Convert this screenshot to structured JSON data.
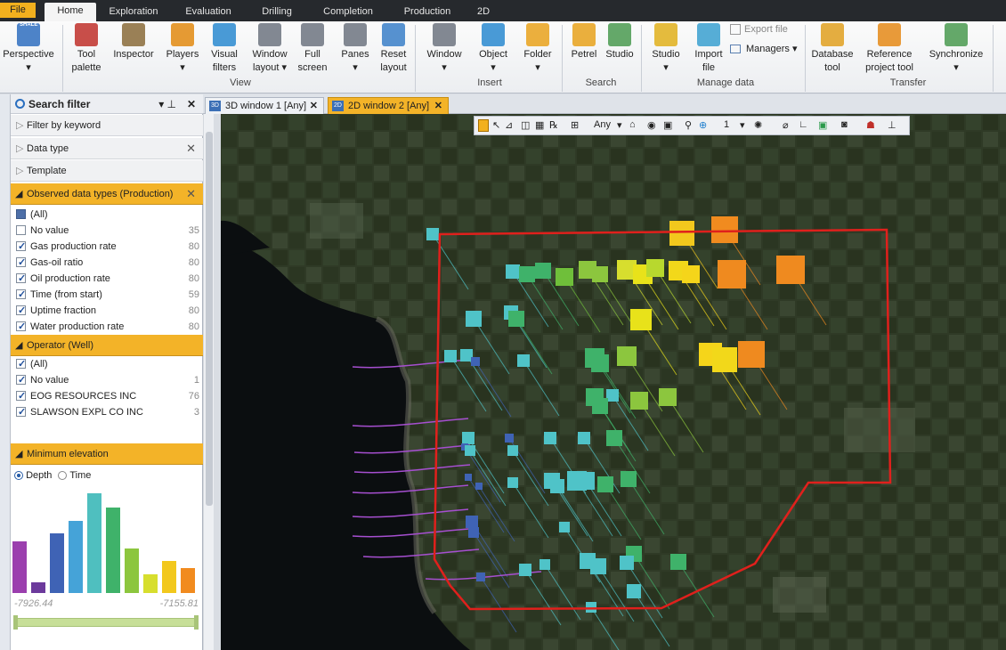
{
  "ribbon_tabs": [
    "File",
    "Home",
    "Exploration",
    "Evaluation",
    "Drilling",
    "Completion",
    "Production",
    "2D"
  ],
  "ribbon": {
    "view_buttons": [
      {
        "name": "perspective",
        "lines": [
          "Perspective",
          "▾"
        ]
      },
      {
        "name": "tool-palette",
        "lines": [
          "Tool",
          "palette"
        ]
      },
      {
        "name": "inspector",
        "lines": [
          "Inspector",
          ""
        ]
      },
      {
        "name": "players",
        "lines": [
          "Players",
          "▾"
        ]
      },
      {
        "name": "visual-filters",
        "lines": [
          "Visual",
          "filters"
        ]
      },
      {
        "name": "window-layout",
        "lines": [
          "Window",
          "layout ▾"
        ]
      },
      {
        "name": "full-screen",
        "lines": [
          "Full",
          "screen"
        ]
      },
      {
        "name": "panes",
        "lines": [
          "Panes",
          "▾"
        ]
      },
      {
        "name": "reset-layout",
        "lines": [
          "Reset",
          "layout"
        ]
      }
    ],
    "insert_buttons": [
      {
        "name": "window",
        "lines": [
          "Window",
          "▾"
        ]
      },
      {
        "name": "object",
        "lines": [
          "Object",
          "▾"
        ]
      },
      {
        "name": "folder",
        "lines": [
          "Folder",
          "▾"
        ]
      }
    ],
    "search_buttons": [
      {
        "name": "petrel",
        "lines": [
          "Petrel",
          ""
        ]
      },
      {
        "name": "studio-search",
        "lines": [
          "Studio",
          ""
        ]
      }
    ],
    "manage_buttons": [
      {
        "name": "studio-manage",
        "lines": [
          "Studio",
          "▾"
        ]
      },
      {
        "name": "import-file",
        "lines": [
          "Import",
          "file"
        ]
      }
    ],
    "export_file": "Export file",
    "managers": "Managers ▾",
    "transfer_buttons": [
      {
        "name": "database-tool",
        "lines": [
          "Database",
          "tool"
        ]
      },
      {
        "name": "reference-project-tool",
        "lines": [
          "Reference",
          "project tool"
        ]
      },
      {
        "name": "synchronize",
        "lines": [
          "Synchronize",
          "▾"
        ]
      }
    ],
    "groups": {
      "view": "View",
      "insert": "Insert",
      "search": "Search",
      "manage": "Manage data",
      "transfer": "Transfer"
    },
    "shale_label": "SHALE"
  },
  "panel": {
    "title": "Search filter",
    "filter_keyword": "Filter by keyword",
    "data_type": "Data type",
    "template": "Template",
    "observed_header": "Observed data types (Production)",
    "observed_items": [
      {
        "label": "(All)",
        "count": "",
        "state": "part"
      },
      {
        "label": "No value",
        "count": "35",
        "state": "off"
      },
      {
        "label": "Gas production rate",
        "count": "80",
        "state": "on"
      },
      {
        "label": "Gas-oil ratio",
        "count": "80",
        "state": "on"
      },
      {
        "label": "Oil production rate",
        "count": "80",
        "state": "on"
      },
      {
        "label": "Time (from start)",
        "count": "59",
        "state": "on"
      },
      {
        "label": "Uptime fraction",
        "count": "80",
        "state": "on"
      },
      {
        "label": "Water production rate",
        "count": "80",
        "state": "on"
      }
    ],
    "operator_header": "Operator (Well)",
    "operator_items": [
      {
        "label": "(All)",
        "count": "",
        "state": "on"
      },
      {
        "label": "No value",
        "count": "1",
        "state": "on"
      },
      {
        "label": "EOG RESOURCES INC",
        "count": "76",
        "state": "on"
      },
      {
        "label": "SLAWSON EXPL CO INC",
        "count": "3",
        "state": "on"
      }
    ],
    "elevation_header": "Minimum elevation",
    "radio_depth": "Depth",
    "radio_time": "Time",
    "hist_min": "-7926.44",
    "hist_max": "-7155.81",
    "histogram": [
      {
        "v": 0.52,
        "c": "#9b3fae"
      },
      {
        "v": 0.11,
        "c": "#6c3a9c"
      },
      {
        "v": 0.6,
        "c": "#3f63b5"
      },
      {
        "v": 0.72,
        "c": "#45a3d8"
      },
      {
        "v": 1.0,
        "c": "#4fbfbf"
      },
      {
        "v": 0.86,
        "c": "#3fb26a"
      },
      {
        "v": 0.45,
        "c": "#8cc63e"
      },
      {
        "v": 0.19,
        "c": "#d7de2e"
      },
      {
        "v": 0.32,
        "c": "#f2c81d"
      },
      {
        "v": 0.25,
        "c": "#f18b1f"
      }
    ]
  },
  "doc_tabs": [
    {
      "label": "3D window 1 [Any]",
      "tag": "3D",
      "active": false
    },
    {
      "label": "2D window 2 [Any]",
      "tag": "2D",
      "active": true
    }
  ],
  "map_toolbar": {
    "any": "Any",
    "one": "1"
  },
  "colors": {
    "accent": "#f3b328",
    "boundary": "#e0201c"
  }
}
